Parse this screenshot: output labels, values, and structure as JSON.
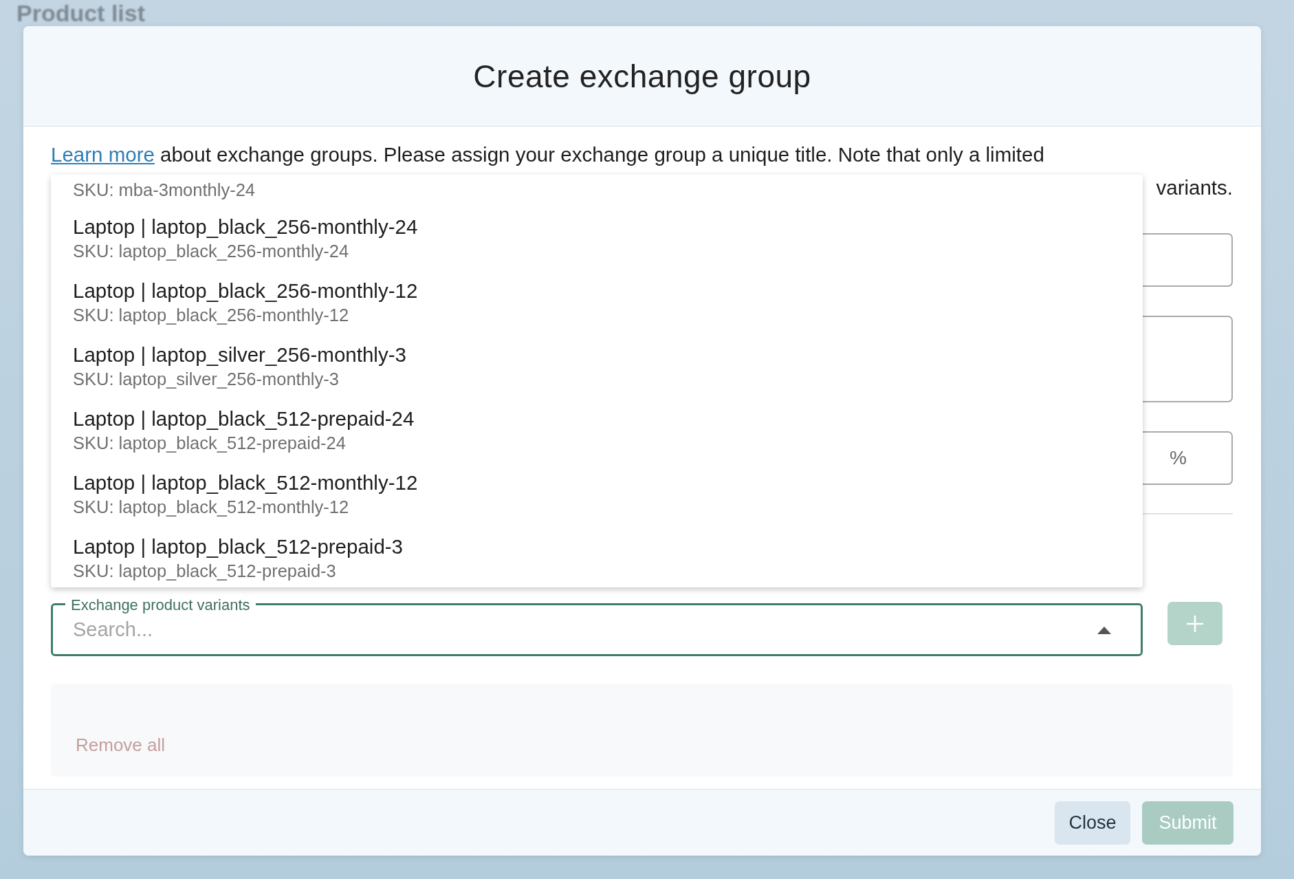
{
  "background_page": {
    "title": "Product list"
  },
  "dialog": {
    "title": "Create exchange group",
    "intro": {
      "link": "Learn more",
      "text": " about exchange groups. Please assign your exchange group a unique title. Note that only a limited",
      "line_2_end": "variants."
    },
    "fields": [
      {
        "kind": "input"
      },
      {
        "kind": "textarea"
      },
      {
        "kind": "input",
        "suffix": "%"
      }
    ],
    "variant_search": {
      "label": "Exchange product variants",
      "placeholder": "Search...",
      "expanded": true,
      "options": [
        {
          "sku": "SKU: mba-3monthly-24"
        },
        {
          "title": "Laptop | laptop_black_256-monthly-24",
          "sku": "SKU: laptop_black_256-monthly-24"
        },
        {
          "title": "Laptop | laptop_black_256-monthly-12",
          "sku": "SKU: laptop_black_256-monthly-12"
        },
        {
          "title": "Laptop | laptop_silver_256-monthly-3",
          "sku": "SKU: laptop_silver_256-monthly-3"
        },
        {
          "title": "Laptop | laptop_black_512-prepaid-24",
          "sku": "SKU: laptop_black_512-prepaid-24"
        },
        {
          "title": "Laptop | laptop_black_512-monthly-12",
          "sku": "SKU: laptop_black_512-monthly-12"
        },
        {
          "title": "Laptop | laptop_black_512-prepaid-3",
          "sku": "SKU: laptop_black_512-prepaid-3"
        }
      ],
      "add_disabled": true
    },
    "remove_all": "Remove all",
    "buttons": [
      {
        "label": "Close",
        "kind": "secondary",
        "disabled": false
      },
      {
        "label": "Submit",
        "kind": "primary",
        "disabled": true
      }
    ]
  }
}
